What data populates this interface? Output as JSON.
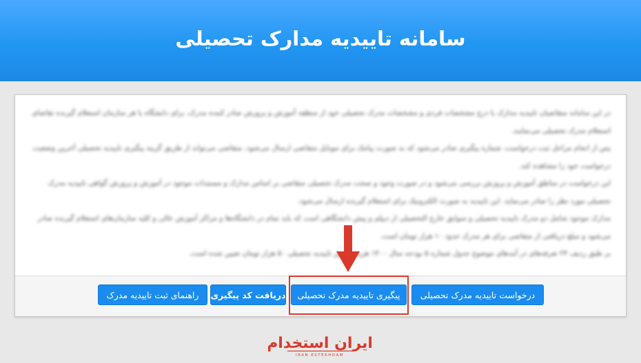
{
  "header": {
    "title": "سامانه تاییدیه مدارک تحصیلی"
  },
  "content": {
    "paragraphs": [
      "در این سامانه متقاضیان تاییدیه مدارک با درج مشخصات فردی و مشخصات مدرک تحصیلی خود از منطقه آموزش و پرورش صادر کننده مدرک، برای دانشگاه یا هر سازمان استعلام گیرنده تقاضای استعلام مدرک تحصیلی می‌نمایند.",
      "پس از انجام مراحل ثبت درخواست، شماره پیگیری صادر می‌شود که به صورت پیامک برای موبایل متقاضی ارسال می‌شود. متقاضی می‌تواند از طریق گزینه پیگیری تاییدیه تحصیلی آخرین وضعیت درخواست خود را مشاهده کند.",
      "این درخواست در مناطق آموزش و پرورش بررسی می‌شود و در صورت وجود و صحت مدرک تحصیلی متقاضی بر اساس مدارک و مستندات موجود در آموزش و پرورش گواهی تاییدیه مدرک تحصیلی مورد نظر را صادر می‌نماید. این تاییدیه به صورت الکترونیک برای استعلام گیرنده ارسال می‌شود.",
      "مدارک موجود شامل دو مدرک تاییدیه تحصیلی و سوابق خارج التحصیلی از دیپلم و پیش دانشگاهی است که باید تمام در دانشگاه‌ها و مراکز آموزش عالی و کلیه سازمان‌های استعلام گیرنده صادر می‌شود و مبلغ دریافتی از متقاضی برای هر مدرک حدود ۱۰ هزار تومان است.",
      "بر طبق ردیف ۲۴ تعرفه‌های در آمدهای موضوع جدول شماره ۵ بودجه سال ۱۴۰۰ هزینه صدور تاییدیه تحصیلی ۵۰ هزار تومان تعیین شده است."
    ]
  },
  "buttons": {
    "request": "درخواست تاییدیه مدرک تحصیلی",
    "track": "پیگیری تاییدیه مدرک تحصیلی",
    "get_code": "دریافت کد پیگیری",
    "guide": "راهنمای ثبت تاییدیه مدرک"
  },
  "annotation": {
    "color": "#d93a2b"
  },
  "logo": {
    "name": "ایران استخدام",
    "sub": "IRAN ESTEKHDAM",
    "color": "#d93a2b"
  }
}
